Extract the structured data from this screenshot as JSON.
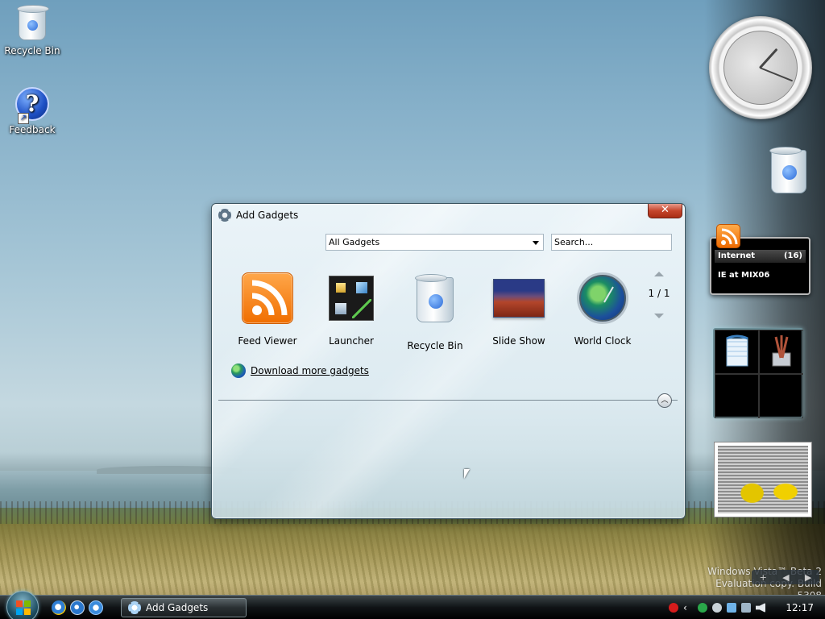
{
  "desktop": {
    "icons": [
      {
        "label": "Recycle Bin",
        "icon": "recycle-bin-icon"
      },
      {
        "label": "Feedback",
        "icon": "help-icon"
      }
    ],
    "watermark": {
      "line1": "Windows Vista™ Beta 2",
      "line2": "Evaluation copy. Build 5308"
    }
  },
  "sidebar": {
    "clock": {
      "icon": "analog-clock-icon"
    },
    "recycle_bin": {
      "icon": "recycle-bin-icon"
    },
    "feed_viewer": {
      "category": "Internet",
      "count": "(16)",
      "item": "IE at MIX06",
      "icon": "rss-feed-icon"
    },
    "controls": {
      "add": "+",
      "prev": "◀",
      "next": "▶"
    }
  },
  "dialog": {
    "title": "Add Gadgets",
    "close_label": "✕",
    "category_select": {
      "value": "All Gadgets"
    },
    "search": {
      "placeholder": "Search..."
    },
    "gadgets": [
      {
        "label": "Feed Viewer",
        "icon": "rss-feed-icon"
      },
      {
        "label": "Launcher",
        "icon": "launcher-icon"
      },
      {
        "label": "Recycle Bin",
        "icon": "recycle-bin-icon"
      },
      {
        "label": "Slide Show",
        "icon": "slide-show-icon"
      },
      {
        "label": "World Clock",
        "icon": "world-clock-icon"
      }
    ],
    "pagination": {
      "page": "1 / 1"
    },
    "download_link": "Download more gadgets",
    "collapse_label": "︿"
  },
  "taskbar": {
    "task_button": "Add Gadgets",
    "clock": "12:17",
    "quick_launch": [
      "internet-explorer-icon",
      "switch-windows-icon",
      "media-player-icon"
    ]
  },
  "colors": {
    "dialog_close": "#c5452c",
    "feed_orange": "#f06e00",
    "taskbar": "#101416"
  }
}
